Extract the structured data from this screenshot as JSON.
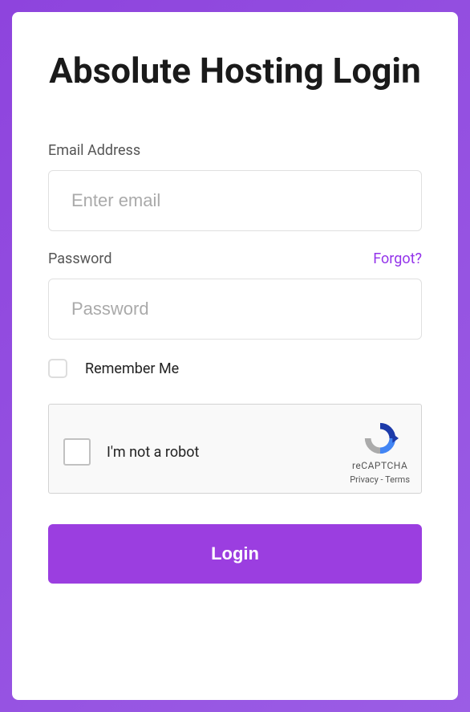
{
  "header": {
    "title": "Absolute Hosting Login"
  },
  "form": {
    "email": {
      "label": "Email Address",
      "placeholder": "Enter email",
      "value": ""
    },
    "password": {
      "label": "Password",
      "placeholder": "Password",
      "forgot_label": "Forgot?",
      "value": ""
    },
    "remember": {
      "label": "Remember Me",
      "checked": false
    }
  },
  "recaptcha": {
    "label": "I'm not a robot",
    "brand": "reCAPTCHA",
    "privacy": "Privacy",
    "terms": "Terms",
    "separator": " - "
  },
  "actions": {
    "login_label": "Login"
  },
  "colors": {
    "accent": "#9b3ee0",
    "link": "#9333ea"
  }
}
